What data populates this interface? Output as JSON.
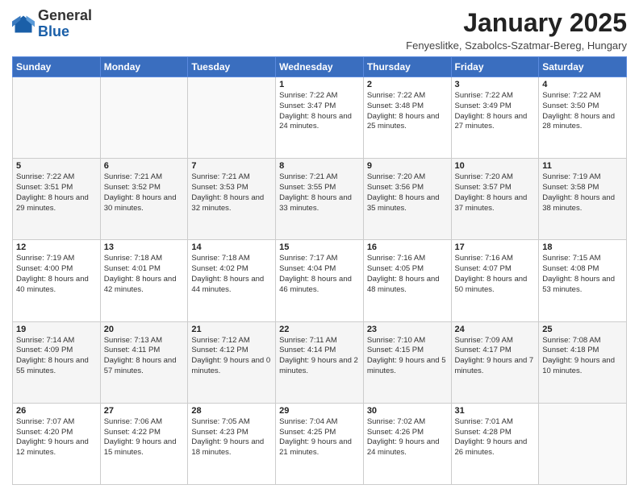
{
  "header": {
    "logo_general": "General",
    "logo_blue": "Blue",
    "month_title": "January 2025",
    "location": "Fenyeslitke, Szabolcs-Szatmar-Bereg, Hungary"
  },
  "weekdays": [
    "Sunday",
    "Monday",
    "Tuesday",
    "Wednesday",
    "Thursday",
    "Friday",
    "Saturday"
  ],
  "weeks": [
    [
      {
        "day": "",
        "info": ""
      },
      {
        "day": "",
        "info": ""
      },
      {
        "day": "",
        "info": ""
      },
      {
        "day": "1",
        "info": "Sunrise: 7:22 AM\nSunset: 3:47 PM\nDaylight: 8 hours\nand 24 minutes."
      },
      {
        "day": "2",
        "info": "Sunrise: 7:22 AM\nSunset: 3:48 PM\nDaylight: 8 hours\nand 25 minutes."
      },
      {
        "day": "3",
        "info": "Sunrise: 7:22 AM\nSunset: 3:49 PM\nDaylight: 8 hours\nand 27 minutes."
      },
      {
        "day": "4",
        "info": "Sunrise: 7:22 AM\nSunset: 3:50 PM\nDaylight: 8 hours\nand 28 minutes."
      }
    ],
    [
      {
        "day": "5",
        "info": "Sunrise: 7:22 AM\nSunset: 3:51 PM\nDaylight: 8 hours\nand 29 minutes."
      },
      {
        "day": "6",
        "info": "Sunrise: 7:21 AM\nSunset: 3:52 PM\nDaylight: 8 hours\nand 30 minutes."
      },
      {
        "day": "7",
        "info": "Sunrise: 7:21 AM\nSunset: 3:53 PM\nDaylight: 8 hours\nand 32 minutes."
      },
      {
        "day": "8",
        "info": "Sunrise: 7:21 AM\nSunset: 3:55 PM\nDaylight: 8 hours\nand 33 minutes."
      },
      {
        "day": "9",
        "info": "Sunrise: 7:20 AM\nSunset: 3:56 PM\nDaylight: 8 hours\nand 35 minutes."
      },
      {
        "day": "10",
        "info": "Sunrise: 7:20 AM\nSunset: 3:57 PM\nDaylight: 8 hours\nand 37 minutes."
      },
      {
        "day": "11",
        "info": "Sunrise: 7:19 AM\nSunset: 3:58 PM\nDaylight: 8 hours\nand 38 minutes."
      }
    ],
    [
      {
        "day": "12",
        "info": "Sunrise: 7:19 AM\nSunset: 4:00 PM\nDaylight: 8 hours\nand 40 minutes."
      },
      {
        "day": "13",
        "info": "Sunrise: 7:18 AM\nSunset: 4:01 PM\nDaylight: 8 hours\nand 42 minutes."
      },
      {
        "day": "14",
        "info": "Sunrise: 7:18 AM\nSunset: 4:02 PM\nDaylight: 8 hours\nand 44 minutes."
      },
      {
        "day": "15",
        "info": "Sunrise: 7:17 AM\nSunset: 4:04 PM\nDaylight: 8 hours\nand 46 minutes."
      },
      {
        "day": "16",
        "info": "Sunrise: 7:16 AM\nSunset: 4:05 PM\nDaylight: 8 hours\nand 48 minutes."
      },
      {
        "day": "17",
        "info": "Sunrise: 7:16 AM\nSunset: 4:07 PM\nDaylight: 8 hours\nand 50 minutes."
      },
      {
        "day": "18",
        "info": "Sunrise: 7:15 AM\nSunset: 4:08 PM\nDaylight: 8 hours\nand 53 minutes."
      }
    ],
    [
      {
        "day": "19",
        "info": "Sunrise: 7:14 AM\nSunset: 4:09 PM\nDaylight: 8 hours\nand 55 minutes."
      },
      {
        "day": "20",
        "info": "Sunrise: 7:13 AM\nSunset: 4:11 PM\nDaylight: 8 hours\nand 57 minutes."
      },
      {
        "day": "21",
        "info": "Sunrise: 7:12 AM\nSunset: 4:12 PM\nDaylight: 9 hours\nand 0 minutes."
      },
      {
        "day": "22",
        "info": "Sunrise: 7:11 AM\nSunset: 4:14 PM\nDaylight: 9 hours\nand 2 minutes."
      },
      {
        "day": "23",
        "info": "Sunrise: 7:10 AM\nSunset: 4:15 PM\nDaylight: 9 hours\nand 5 minutes."
      },
      {
        "day": "24",
        "info": "Sunrise: 7:09 AM\nSunset: 4:17 PM\nDaylight: 9 hours\nand 7 minutes."
      },
      {
        "day": "25",
        "info": "Sunrise: 7:08 AM\nSunset: 4:18 PM\nDaylight: 9 hours\nand 10 minutes."
      }
    ],
    [
      {
        "day": "26",
        "info": "Sunrise: 7:07 AM\nSunset: 4:20 PM\nDaylight: 9 hours\nand 12 minutes."
      },
      {
        "day": "27",
        "info": "Sunrise: 7:06 AM\nSunset: 4:22 PM\nDaylight: 9 hours\nand 15 minutes."
      },
      {
        "day": "28",
        "info": "Sunrise: 7:05 AM\nSunset: 4:23 PM\nDaylight: 9 hours\nand 18 minutes."
      },
      {
        "day": "29",
        "info": "Sunrise: 7:04 AM\nSunset: 4:25 PM\nDaylight: 9 hours\nand 21 minutes."
      },
      {
        "day": "30",
        "info": "Sunrise: 7:02 AM\nSunset: 4:26 PM\nDaylight: 9 hours\nand 24 minutes."
      },
      {
        "day": "31",
        "info": "Sunrise: 7:01 AM\nSunset: 4:28 PM\nDaylight: 9 hours\nand 26 minutes."
      },
      {
        "day": "",
        "info": ""
      }
    ]
  ]
}
